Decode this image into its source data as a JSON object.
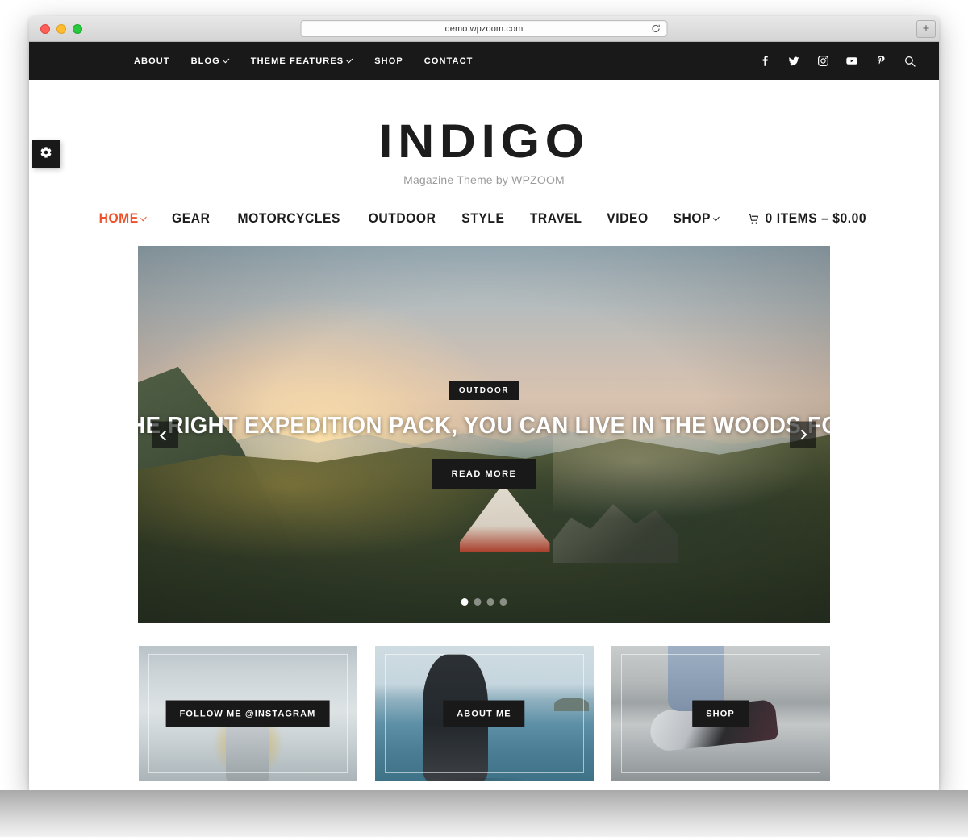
{
  "browser": {
    "url": "demo.wpzoom.com",
    "reload_icon": "reload-icon",
    "new_tab_label": "+",
    "traffic_lights": [
      "close",
      "minimize",
      "maximize"
    ]
  },
  "topbar": {
    "menu": [
      {
        "label": "ABOUT",
        "has_dropdown": false
      },
      {
        "label": "BLOG",
        "has_dropdown": true
      },
      {
        "label": "THEME FEATURES",
        "has_dropdown": true
      },
      {
        "label": "SHOP",
        "has_dropdown": false
      },
      {
        "label": "CONTACT",
        "has_dropdown": false
      }
    ],
    "social": [
      {
        "name": "facebook-icon"
      },
      {
        "name": "twitter-icon"
      },
      {
        "name": "instagram-icon"
      },
      {
        "name": "youtube-icon"
      },
      {
        "name": "pinterest-icon"
      },
      {
        "name": "search-icon"
      }
    ],
    "background": "#191919"
  },
  "brand": {
    "title": "INDIGO",
    "tagline": "Magazine Theme by WPZOOM"
  },
  "mainmenu": {
    "accent_color": "#ef512a",
    "items": [
      {
        "label": "HOME",
        "active": true,
        "has_dropdown": true
      },
      {
        "label": "GEAR",
        "active": false,
        "has_dropdown": false
      },
      {
        "label": "MOTORCYCLES",
        "active": false,
        "has_dropdown": false
      },
      {
        "label": "OUTDOOR",
        "active": false,
        "has_dropdown": false
      },
      {
        "label": "STYLE",
        "active": false,
        "has_dropdown": false
      },
      {
        "label": "TRAVEL",
        "active": false,
        "has_dropdown": false
      },
      {
        "label": "VIDEO",
        "active": false,
        "has_dropdown": false
      },
      {
        "label": "SHOP",
        "active": false,
        "has_dropdown": true
      }
    ],
    "cart": {
      "icon": "cart-icon",
      "label": "0 ITEMS – $0.00",
      "item_count": 0,
      "total": "$0.00"
    }
  },
  "hero": {
    "category": "OUTDOOR",
    "title": "WITH THE RIGHT EXPEDITION PACK, YOU CAN LIVE IN THE WOODS FOREVER",
    "button_label": "READ MORE",
    "prev_label": "previous-slide",
    "next_label": "next-slide",
    "slide_count": 4,
    "active_slide": 1,
    "image_alt": "Camper with tent on a mountain ridge at sunset"
  },
  "promos": [
    {
      "label": "FOLLOW ME @INSTAGRAM",
      "theme": "bg-instagram",
      "name": "promo-instagram",
      "image_alt": "Hiker with backpack in front of snowy waterfall"
    },
    {
      "label": "ABOUT ME",
      "theme": "bg-about",
      "name": "promo-about",
      "image_alt": "Man in black hoodie by the sea"
    },
    {
      "label": "SHOP",
      "theme": "bg-shop",
      "name": "promo-shop",
      "image_alt": "Sneakers on concrete steps"
    }
  ],
  "sidetab": {
    "icon": "gear-icon",
    "title": "Theme options"
  }
}
